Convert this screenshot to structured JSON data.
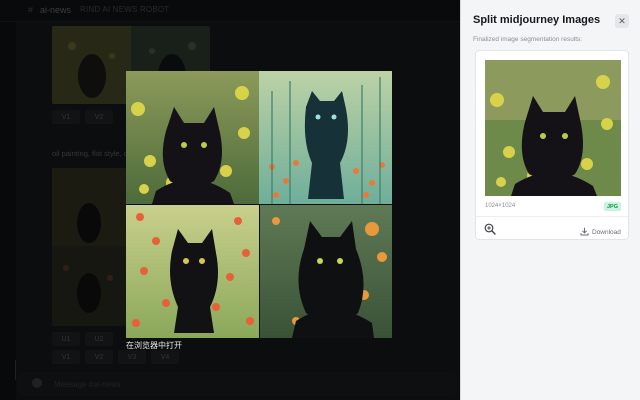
{
  "background": {
    "channel": "ai-news",
    "topic": "RIND AI NEWS ROBOT",
    "message_text": "oil painting, flat style, cat in garden, black cat ... There are all ki ... around, background, c",
    "buttons_row1": [
      "V1",
      "V2"
    ],
    "buttons_row2": [
      "V1",
      "V2",
      "V3",
      "V4"
    ],
    "buttons_row2_top": [
      "U1",
      "U2"
    ],
    "input_placeholder": "Message #ai-news"
  },
  "lightbox": {
    "open_in_browser": "在浏览器中打开"
  },
  "panel": {
    "title": "Split midjourney Images",
    "close_icon": "close-icon",
    "subtitle": "Finalized image segmentation results:",
    "card": {
      "dimensions": "1024×1024",
      "format": "JPG",
      "download_label": "Download",
      "zoom_icon": "zoom-in-icon",
      "download_icon": "download-icon"
    }
  },
  "colors": {
    "panel_bg": "#f4f5f7",
    "badge_bg": "#c8f3dd",
    "badge_text": "#14924e",
    "backdrop": "#17181b"
  }
}
